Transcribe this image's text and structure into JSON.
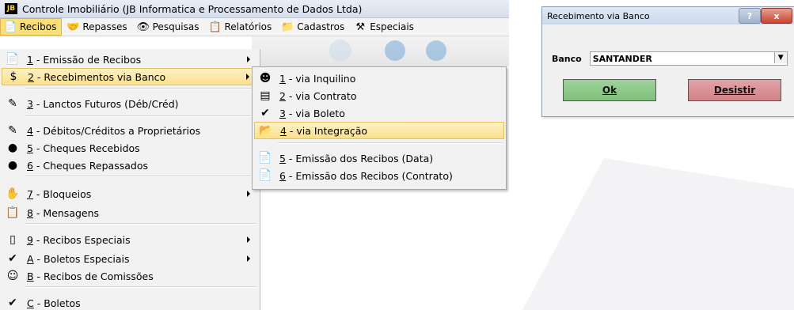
{
  "app": {
    "logo_text": "JB",
    "title": "Controle Imobiliário (JB Informatica e Processamento de Dados Ltda)"
  },
  "menubar": {
    "items": [
      {
        "label": "Recibos",
        "icon": "receipt-icon",
        "active": true
      },
      {
        "label": "Repasses",
        "icon": "handshake-icon",
        "active": false
      },
      {
        "label": "Pesquisas",
        "icon": "binoculars-icon",
        "active": false
      },
      {
        "label": "Relatórios",
        "icon": "report-icon",
        "active": false
      },
      {
        "label": "Cadastros",
        "icon": "cards-icon",
        "active": false
      },
      {
        "label": "Especiais",
        "icon": "tools-icon",
        "active": false
      }
    ]
  },
  "recibos_menu": {
    "items": [
      {
        "key": "1",
        "label": " - Emissão de Recibos",
        "icon": "document-icon",
        "submenu": true
      },
      {
        "key": "2",
        "label": " - Recebimentos via Banco",
        "icon": "dollar-icon",
        "submenu": true,
        "highlighted": true
      },
      {
        "key": "3",
        "label": " - Lanctos Futuros (Déb/Créd)",
        "icon": "calculator-icon"
      },
      {
        "key": "4",
        "label": " - Débitos/Créditos a Proprietários",
        "icon": "calculator-icon"
      },
      {
        "key": "5",
        "label": " - Cheques Recebidos",
        "icon": "piggybank-icon"
      },
      {
        "key": "6",
        "label": " - Cheques Repassados",
        "icon": "piggybank-icon"
      },
      {
        "key": "7",
        "label": " - Bloqueios",
        "icon": "hand-icon",
        "submenu": true
      },
      {
        "key": "8",
        "label": " - Mensagens",
        "icon": "clipboard-icon"
      },
      {
        "key": "9",
        "label": " - Recibos Especiais",
        "icon": "blank-doc-icon",
        "submenu": true
      },
      {
        "key": "A",
        "label": " - Boletos Especiais",
        "icon": "check-mark-icon",
        "submenu": true
      },
      {
        "key": "B",
        "label": " - Recibos de Comissões",
        "icon": "smiley-icon"
      },
      {
        "key": "C",
        "label": " - Boletos",
        "icon": "check-mark-icon"
      }
    ]
  },
  "submenu": {
    "items": [
      {
        "key": "1",
        "label": " - via Inquilino",
        "icon": "person-icon"
      },
      {
        "key": "2",
        "label": " - via Contrato",
        "icon": "contract-icon"
      },
      {
        "key": "3",
        "label": " - via Boleto",
        "icon": "check-mark-icon"
      },
      {
        "key": "4",
        "label": " - via Integração",
        "icon": "folder-icon",
        "highlighted": true
      },
      {
        "key": "5",
        "label": " - Emissão dos Recibos (Data)",
        "icon": "document-icon"
      },
      {
        "key": "6",
        "label": " - Emissão dos Recibos (Contrato)",
        "icon": "document-icon"
      }
    ]
  },
  "dialog": {
    "title": "Recebimento via Banco",
    "help_label": "?",
    "close_label": "x",
    "banco_label": "Banco",
    "banco_value": "SANTANDER",
    "ok_label": "Ok",
    "desistir_label": "Desistir"
  },
  "colors": {
    "highlight": "#fbe08c",
    "ok_button": "#8fc98b",
    "desistir_button": "#d9939a"
  }
}
